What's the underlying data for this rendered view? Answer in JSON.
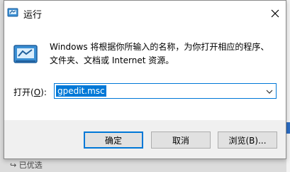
{
  "window": {
    "title": "运行"
  },
  "dialog": {
    "description_line1": "Windows 将根据你所输入的名称，为你打开相应的程序、",
    "description_line2": "文件夹、文档或 Internet 资源。",
    "open_label_prefix": "打开(",
    "open_label_key": "O",
    "open_label_suffix": "):",
    "command_value": "gpedit.msc"
  },
  "buttons": {
    "ok": "确定",
    "cancel": "取消",
    "browse": "浏览(B)..."
  },
  "background": {
    "bottom_text": "↪ 已优选"
  },
  "icons": {
    "title": "run-icon",
    "body": "run-large-icon",
    "close": "close-icon",
    "dropdown": "chevron-down-icon"
  },
  "colors": {
    "accent": "#0078d7",
    "button_face": "#e1e1e1"
  }
}
